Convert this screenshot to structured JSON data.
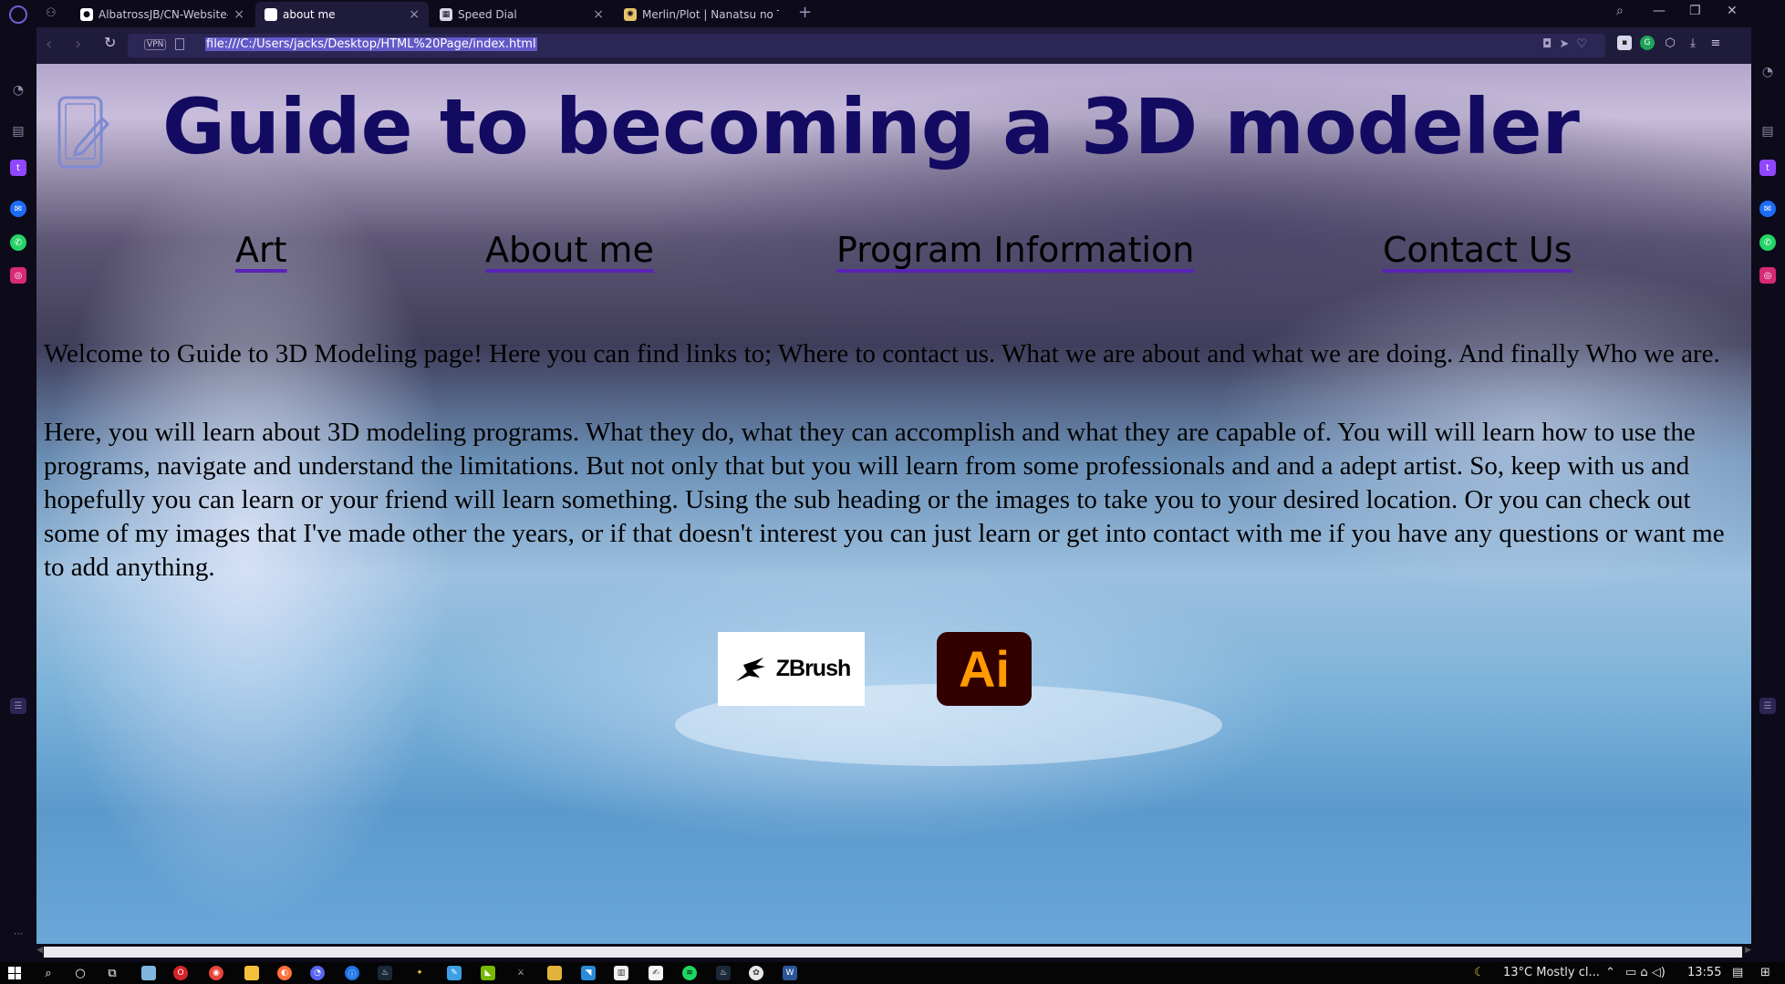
{
  "browser": {
    "tabs": [
      {
        "title": "AlbatrossJB/CN-Website-H",
        "icon": "github-icon"
      },
      {
        "title": "about me",
        "icon": "document-icon",
        "active": true
      },
      {
        "title": "Speed Dial",
        "icon": "speed-dial-icon"
      },
      {
        "title": "Merlin/Plot | Nanatsu no Ta",
        "icon": "wiki-icon"
      }
    ],
    "new_tab_symbol": "+",
    "address_bar": {
      "vpn_label": "VPN",
      "url": "file:///C:/Users/jacks/Desktop/HTML%20Page/index.html"
    }
  },
  "page": {
    "title": "Guide to becoming a 3D modeler",
    "nav": [
      {
        "label": "Art"
      },
      {
        "label": "About me"
      },
      {
        "label": "Program Information"
      },
      {
        "label": "Contact Us"
      }
    ],
    "paragraphs": [
      "Welcome to Guide to 3D Modeling page! Here you can find links to; Where to contact us. What we are about and what we are doing. And finally Who we are.",
      "Here, you will learn about 3D modeling programs. What they do, what they can accomplish and what they are capable of. You will will learn how to use the programs, navigate and understand the limitations. But not only that but you will learn from some professionals and and a adept artist. So, keep with us and hopefully you can learn or your friend will learn something. Using the sub heading or the images to take you to your desired location. Or you can check out some of my images that I've made other the years, or if that doesn't interest you can just learn or get into contact with me if you have any questions or want me to add anything."
    ],
    "images": [
      {
        "name": "ZBrush logo",
        "text": "ZBrush"
      },
      {
        "name": "Adobe Illustrator logo",
        "text": "Ai"
      }
    ]
  },
  "taskbar": {
    "weather": "13°C  Mostly cl...",
    "time": "13:55"
  },
  "colors": {
    "title": "#130b62",
    "nav_underline": "#5a23b6",
    "browser_bg": "#0d0b1a",
    "accent": "#6359c7",
    "ai_orange": "#ff9a00",
    "ai_bg": "#330000"
  }
}
